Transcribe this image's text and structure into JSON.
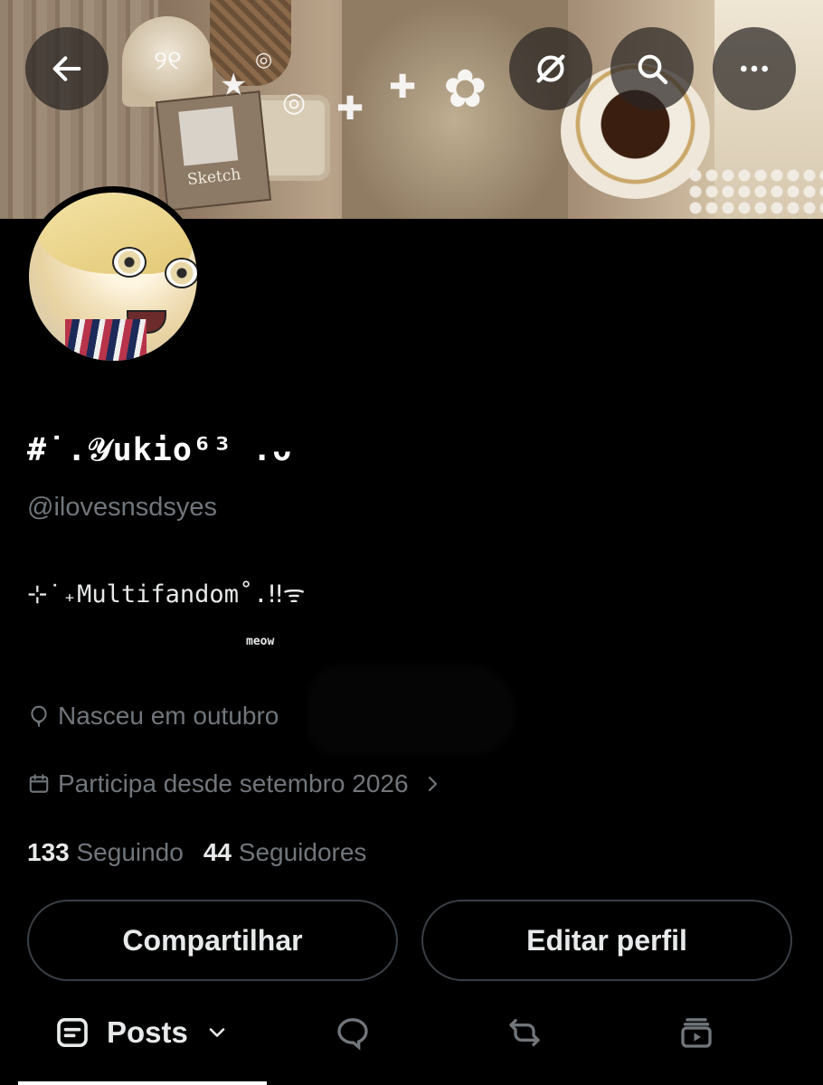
{
  "header": {
    "back_icon": "arrow-left-icon",
    "grok_icon": "grok-icon",
    "search_icon": "search-icon",
    "more_icon": "more-horizontal-icon"
  },
  "banner": {
    "sketchbook_label": "Sketch"
  },
  "profile": {
    "display_name": "#˙.𝒴ukio⁶³ .ᴗ",
    "handle": "@ilovesnsdsyes",
    "bio_line1": "⊹˙₊Multifandom˚.‼︎ᯤ",
    "bio_line2": "meow",
    "birthday": "Nasceu em outubro",
    "joined": "Participa desde setembro 2026",
    "following_count": "133",
    "following_label": "Seguindo",
    "followers_count": "44",
    "followers_label": "Seguidores"
  },
  "actions": {
    "share_label": "Compartilhar",
    "edit_label": "Editar perfil"
  },
  "tabs": {
    "posts_label": "Posts"
  },
  "colors": {
    "background": "#000000",
    "text_primary": "#e7e9ea",
    "text_secondary": "#71767b",
    "border": "#3a3f44"
  }
}
